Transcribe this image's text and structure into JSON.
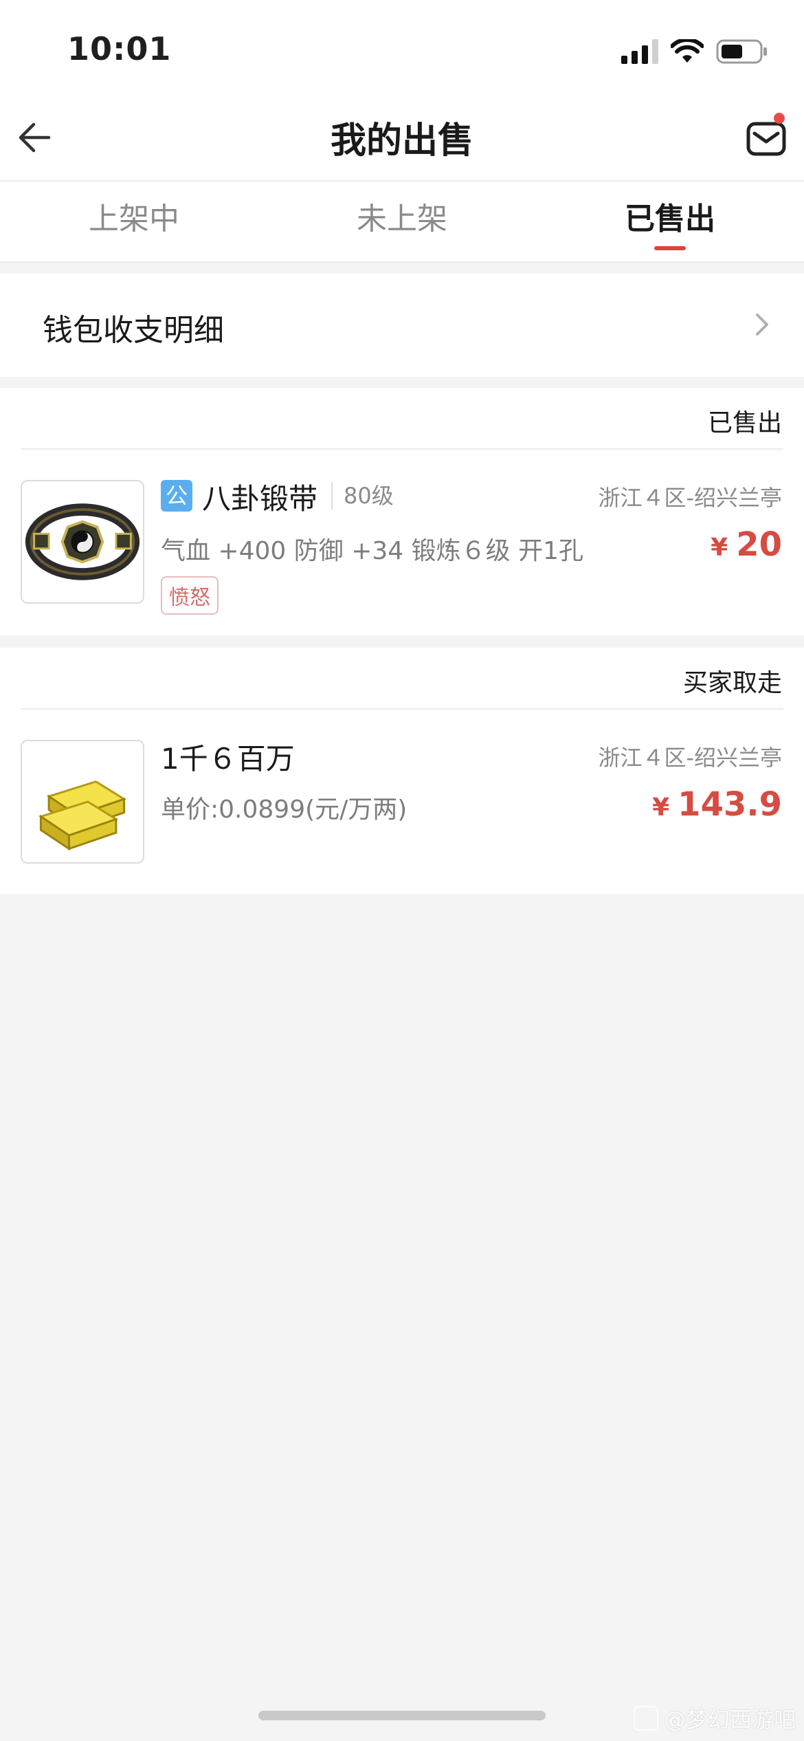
{
  "status_bar": {
    "time": "10:01"
  },
  "nav": {
    "title": "我的出售"
  },
  "tabs": [
    {
      "label": "上架中",
      "active": false
    },
    {
      "label": "未上架",
      "active": false
    },
    {
      "label": "已售出",
      "active": true
    }
  ],
  "wallet": {
    "label": "钱包收支明细"
  },
  "orders": [
    {
      "status": "已售出",
      "badge": "公",
      "name": "八卦锻带",
      "level": "80级",
      "server": "浙江４区-绍兴兰亭",
      "attributes": "气血 +400 防御 +34 锻炼６级 开1孔",
      "tag": "愤怒",
      "currency": "¥",
      "price": "20",
      "image_icon": "belt-icon"
    },
    {
      "status": "买家取走",
      "name": "1千６百万",
      "server": "浙江４区-绍兴兰亭",
      "unit_price": "单价:0.0899(元/万两)",
      "currency": "¥",
      "price": "143.9",
      "image_icon": "gold-ingot-icon"
    }
  ],
  "watermark": {
    "text": "@梦幻西游吧"
  },
  "colors": {
    "accent": "#d9463e",
    "price": "#d64b42",
    "badge": "#5aaef0",
    "background": "#f4f4f4"
  }
}
